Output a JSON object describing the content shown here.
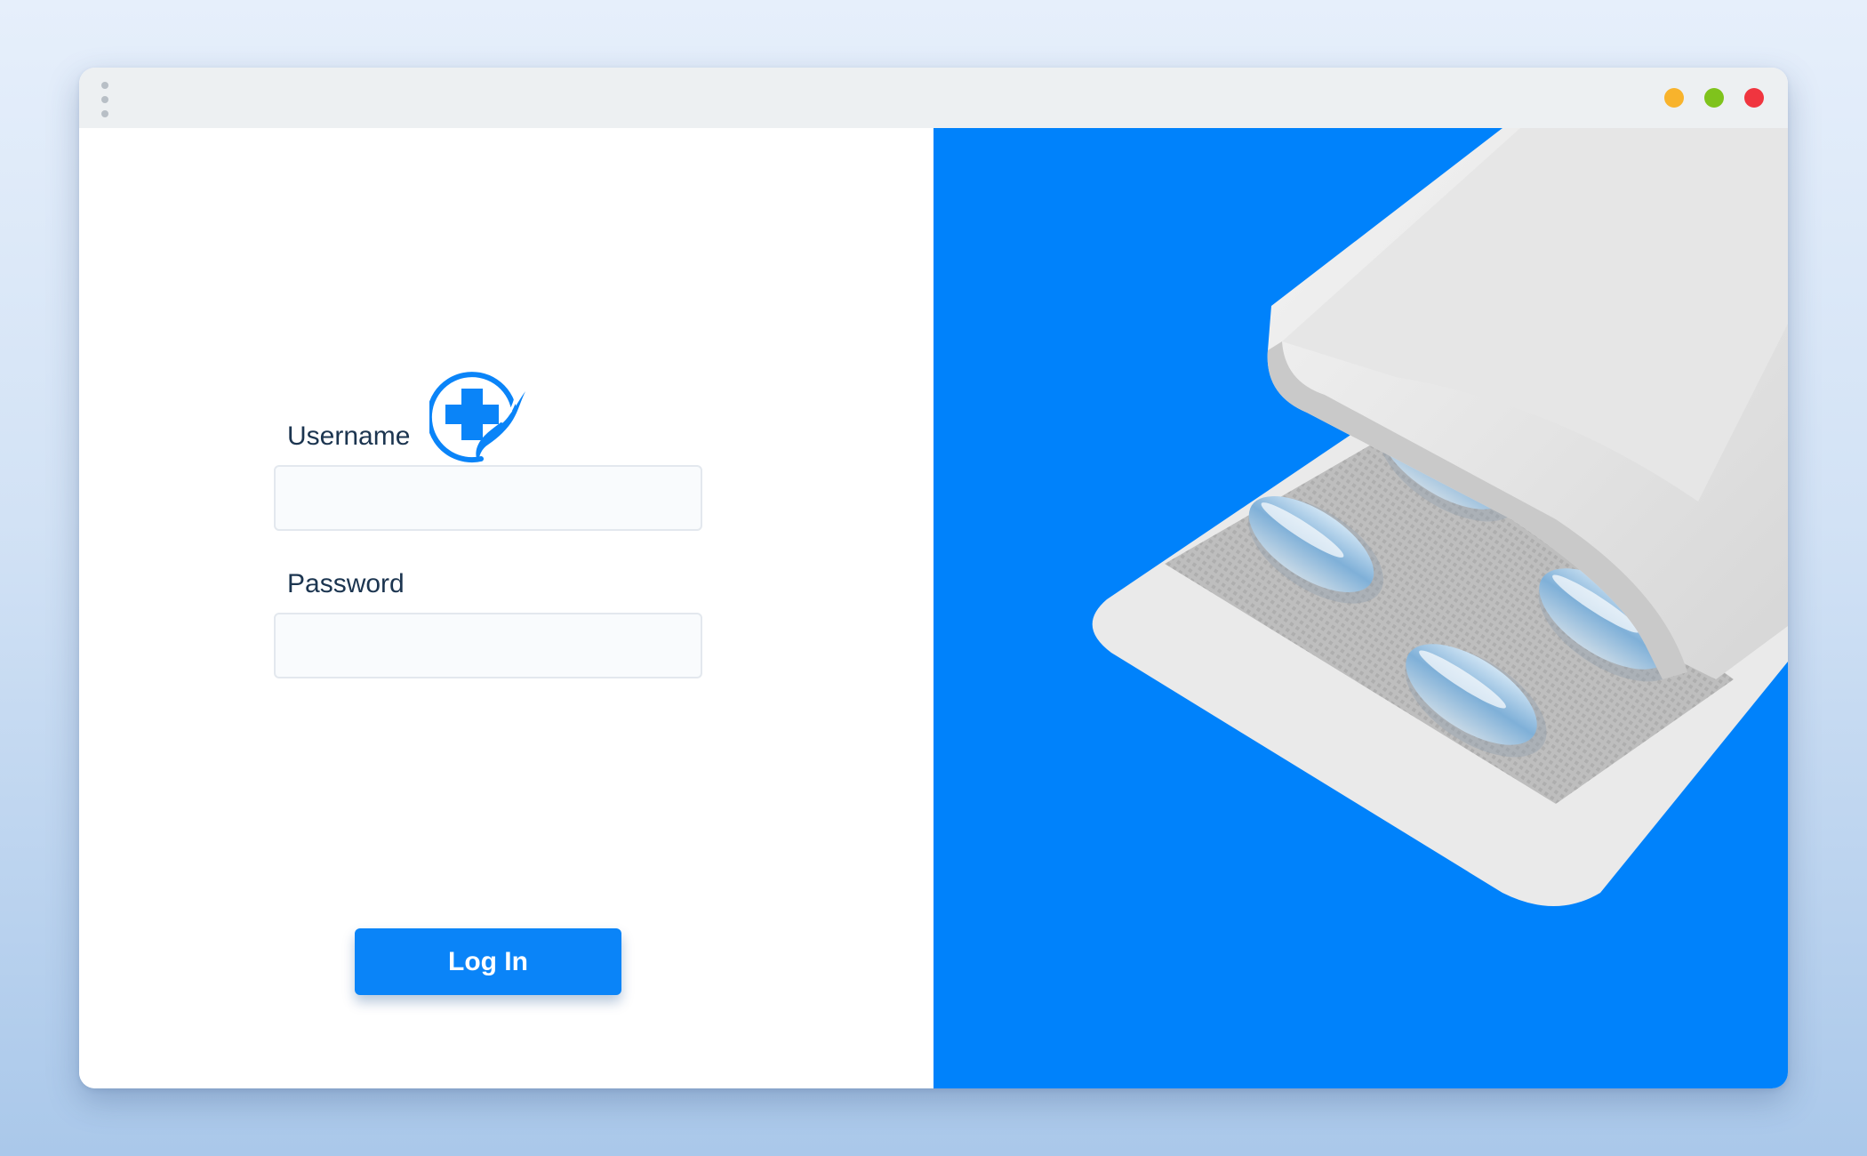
{
  "window": {
    "controls": [
      "minimize",
      "maximize",
      "close"
    ],
    "colors": {
      "minimize": "#f8b32c",
      "maximize": "#7fc31c",
      "close": "#f0353f"
    }
  },
  "login": {
    "logo_icon": "medical-cross-hand-icon",
    "username_label": "Username",
    "username_value": "",
    "password_label": "Password",
    "password_value": "",
    "submit_label": "Log In"
  },
  "hero": {
    "image": "blister-pack-capsules-image",
    "background_color": "#0082fb"
  },
  "colors": {
    "accent": "#0a84f8",
    "label_text": "#1c3550"
  }
}
